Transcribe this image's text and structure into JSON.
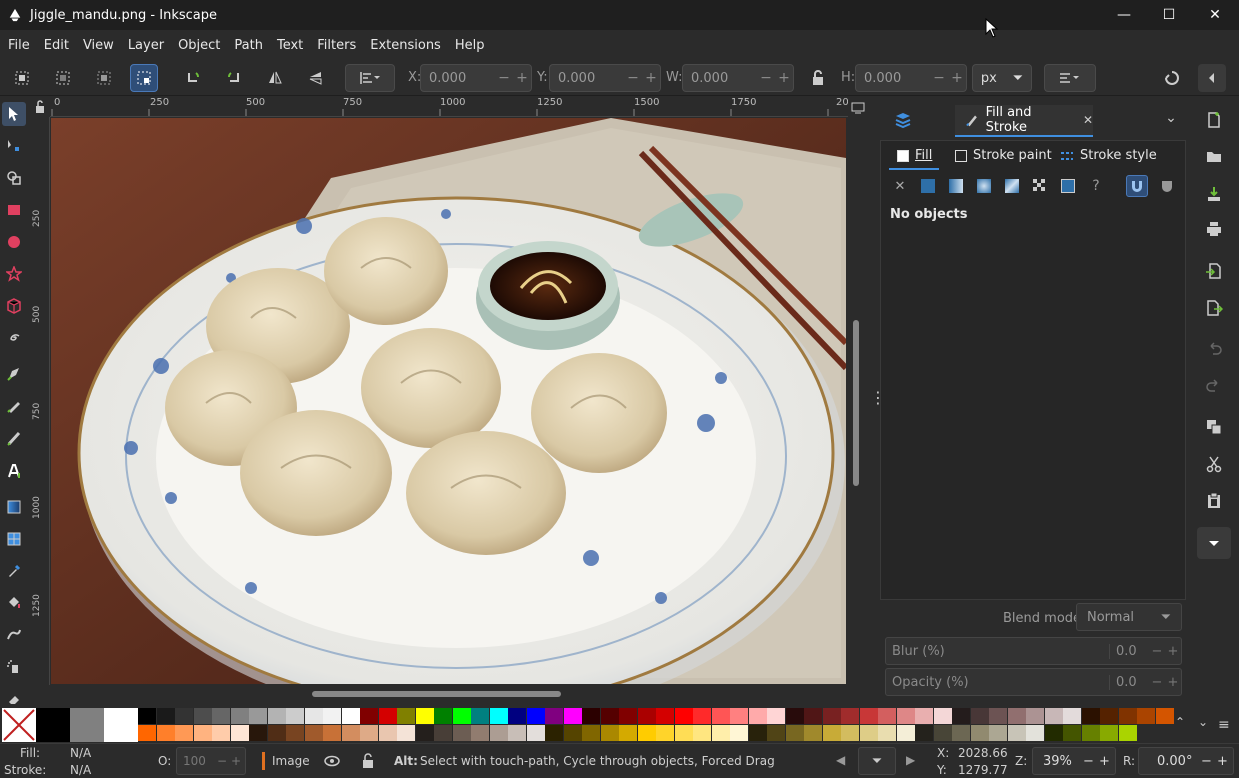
{
  "window": {
    "title": "Jiggle_mandu.png - Inkscape",
    "controls": [
      "—",
      "☐",
      "✕"
    ]
  },
  "menu": {
    "items": [
      "File",
      "Edit",
      "View",
      "Layer",
      "Object",
      "Path",
      "Text",
      "Filters",
      "Extensions",
      "Help"
    ]
  },
  "toolbar": {
    "x_label": "X:",
    "x_value": "0.000",
    "y_label": "Y:",
    "y_value": "0.000",
    "w_label": "W:",
    "w_value": "0.000",
    "h_label": "H:",
    "h_value": "0.000",
    "unit": "px",
    "minus": "−",
    "plus": "+"
  },
  "ruler": {
    "h_ticks": [
      "0",
      "250",
      "500",
      "750",
      "1000",
      "1250",
      "1500",
      "1750",
      "20"
    ],
    "v_ticks": [
      "250",
      "500",
      "750",
      "1000",
      "1250"
    ]
  },
  "dock": {
    "tab_label": "Fill and Stroke",
    "tab_close": "✕",
    "subtabs": {
      "fill": "Fill",
      "stroke_paint": "Stroke paint",
      "stroke_style": "Stroke style"
    },
    "unknown_glyph": "?",
    "no_objects": "No objects",
    "blend_label": "Blend mode:",
    "blend_value": "Normal",
    "blur_label": "Blur (%)",
    "blur_value": "0.0",
    "opacity_label": "Opacity (%)",
    "opacity_value": "0.0"
  },
  "palette": {
    "row1": [
      "#000000",
      "#1a1a1a",
      "#333333",
      "#4d4d4d",
      "#666666",
      "#808080",
      "#999999",
      "#b3b3b3",
      "#cccccc",
      "#e6e6e6",
      "#f2f2f2",
      "#ffffff",
      "#800000",
      "#d40000",
      "#808000",
      "#ffff00",
      "#008000",
      "#00ff00",
      "#008080",
      "#00ffff",
      "#000080",
      "#0000ff",
      "#800080",
      "#ff00ff",
      "#2b0000",
      "#550000",
      "#800000",
      "#aa0000",
      "#d40000",
      "#ff0000",
      "#ff2a2a",
      "#ff5555",
      "#ff8080",
      "#ffaaaa",
      "#ffd5d5",
      "#280b0b",
      "#501616",
      "#782121",
      "#a02c2c",
      "#c83737",
      "#d35f5f",
      "#de8787",
      "#e9afaf",
      "#f4d7d7",
      "#241c1c",
      "#483737",
      "#6c5353",
      "#916f6f",
      "#ac9393",
      "#c8b7b7",
      "#e3dbdb",
      "#2b1100",
      "#552200",
      "#803300",
      "#aa4400",
      "#d45500"
    ],
    "row2": [
      "#ff6600",
      "#ff7f2a",
      "#ff9955",
      "#ffb380",
      "#ffccaa",
      "#ffe6d5",
      "#28170b",
      "#502d16",
      "#784421",
      "#a05a2c",
      "#c87137",
      "#d38d5f",
      "#deaa87",
      "#e9c6af",
      "#f4e3d7",
      "#241f1c",
      "#483e37",
      "#6c5d53",
      "#917c6f",
      "#ac9d93",
      "#c8beb7",
      "#e3dedb",
      "#2b2200",
      "#554400",
      "#806600",
      "#aa8800",
      "#d4aa00",
      "#ffcc00",
      "#ffd42a",
      "#ffdd55",
      "#ffe680",
      "#ffeeaa",
      "#fff6d5",
      "#28220b",
      "#504416",
      "#786721",
      "#a0892c",
      "#c8ab37",
      "#d3bc5f",
      "#decd87",
      "#e9ddaf",
      "#f4eed7",
      "#24221c",
      "#484537",
      "#6c6753",
      "#918a6f",
      "#aca793",
      "#c8c4b7",
      "#e3e2db",
      "#222b00",
      "#445500",
      "#668000",
      "#88aa00",
      "#aad400"
    ]
  },
  "status": {
    "fill_label": "Fill:",
    "fill_value": "N/A",
    "stroke_label": "Stroke:",
    "stroke_value": "N/A",
    "opacity_label": "O:",
    "opacity_value": "100",
    "layer": "Image",
    "message_bold": "Alt:",
    "message": "Select with touch-path, Cycle through objects, Forced Drag",
    "x_label": "X:",
    "x_value": "2028.66",
    "y_label": "Y:",
    "y_value": "1279.77",
    "zoom_label": "Z:",
    "zoom_value": "39%",
    "rot_label": "R:",
    "rot_value": "0.00°"
  },
  "colors": {
    "accent": "#2f4e78",
    "accent_border": "#4a79b8",
    "tool_red": "#e04060",
    "tool_green": "#6fbf3a",
    "tool_blue": "#3f8fe0"
  }
}
